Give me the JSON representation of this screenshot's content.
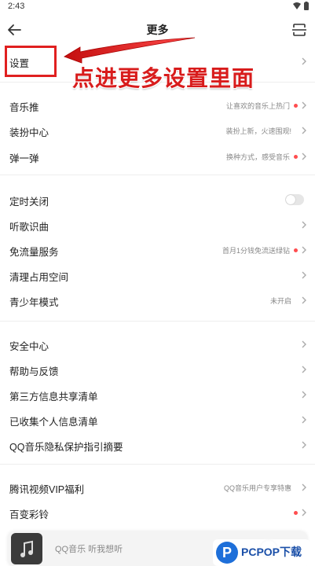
{
  "status": {
    "time": "2:43"
  },
  "header": {
    "title": "更多"
  },
  "annotation": {
    "text": "点进更多设置里面"
  },
  "rows": [
    {
      "label": "设置",
      "sub": "",
      "dot": false,
      "chevron": true,
      "toggle": false
    },
    {
      "label": "音乐推",
      "sub": "让喜欢的音乐上热门",
      "dot": true,
      "chevron": true,
      "toggle": false
    },
    {
      "label": "装扮中心",
      "sub": "装扮上新，火速围观!",
      "dot": false,
      "chevron": true,
      "toggle": false
    },
    {
      "label": "弹一弹",
      "sub": "换种方式，感受音乐",
      "dot": true,
      "chevron": true,
      "toggle": false
    },
    {
      "label": "定时关闭",
      "sub": "",
      "dot": false,
      "chevron": false,
      "toggle": true
    },
    {
      "label": "听歌识曲",
      "sub": "",
      "dot": false,
      "chevron": true,
      "toggle": false
    },
    {
      "label": "免流量服务",
      "sub": "首月1分钱免流送绿钻",
      "dot": true,
      "chevron": true,
      "toggle": false
    },
    {
      "label": "清理占用空间",
      "sub": "",
      "dot": false,
      "chevron": true,
      "toggle": false
    },
    {
      "label": "青少年模式",
      "sub": "未开启",
      "dot": false,
      "chevron": true,
      "toggle": false
    },
    {
      "label": "安全中心",
      "sub": "",
      "dot": false,
      "chevron": true,
      "toggle": false
    },
    {
      "label": "帮助与反馈",
      "sub": "",
      "dot": false,
      "chevron": true,
      "toggle": false
    },
    {
      "label": "第三方信息共享清单",
      "sub": "",
      "dot": false,
      "chevron": true,
      "toggle": false
    },
    {
      "label": "已收集个人信息清单",
      "sub": "",
      "dot": false,
      "chevron": true,
      "toggle": false
    },
    {
      "label": "QQ音乐隐私保护指引摘要",
      "sub": "",
      "dot": false,
      "chevron": true,
      "toggle": false
    },
    {
      "label": "腾讯视频VIP福利",
      "sub": "QQ音乐用户专享特惠",
      "dot": false,
      "chevron": true,
      "toggle": false
    },
    {
      "label": "百变彩铃",
      "sub": "",
      "dot": true,
      "chevron": true,
      "toggle": false
    }
  ],
  "player": {
    "text": "QQ音乐 听我想听"
  },
  "watermark": {
    "text": "PCPOP下载"
  },
  "colors": {
    "accent_red": "#e02020",
    "dot_red": "#ff4d4f",
    "divider": "#eeeeee"
  }
}
